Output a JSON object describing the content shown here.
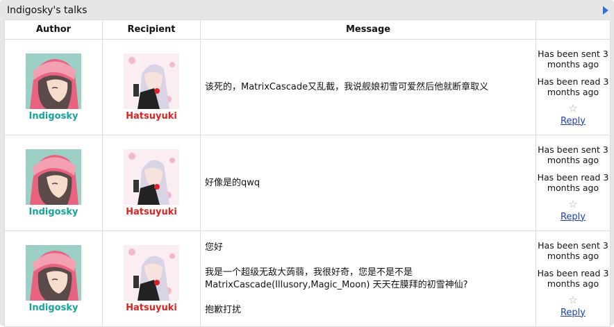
{
  "panel": {
    "title": "Indigosky's talks",
    "colors": {
      "author": "#17a39b",
      "recipient": "#e0221e",
      "link": "#1a3fb8",
      "accent": "#2f6fd6"
    }
  },
  "table": {
    "headers": {
      "author": "Author",
      "recipient": "Recipient",
      "message": "Message",
      "status": ""
    },
    "rows": [
      {
        "author": "Indigosky",
        "recipient": "Hatsuyuki",
        "message": [
          "该死的，MatrixCascade又乱截，我说舰娘初雪可爱然后他就断章取义"
        ],
        "sent": "Has been sent 3 months ago",
        "read": "Has been read 3 months ago",
        "star_icon": "star-outline-icon",
        "reply": "Reply"
      },
      {
        "author": "Indigosky",
        "recipient": "Hatsuyuki",
        "message": [
          "好像是的qwq"
        ],
        "sent": "Has been sent 3 months ago",
        "read": "Has been read 3 months ago",
        "star_icon": "star-outline-icon",
        "reply": "Reply"
      },
      {
        "author": "Indigosky",
        "recipient": "Hatsuyuki",
        "message": [
          "您好",
          "我是一个超级无敌大蒟蒻，我很好奇，您是不是不是MatrixCascade(Illusory,Magic_Moon) 天天在膜拜的初雪神仙?",
          "抱歉打扰"
        ],
        "sent": "Has been sent 3 months ago",
        "read": "Has been read 3 months ago",
        "star_icon": "star-outline-icon",
        "reply": "Reply"
      }
    ]
  }
}
